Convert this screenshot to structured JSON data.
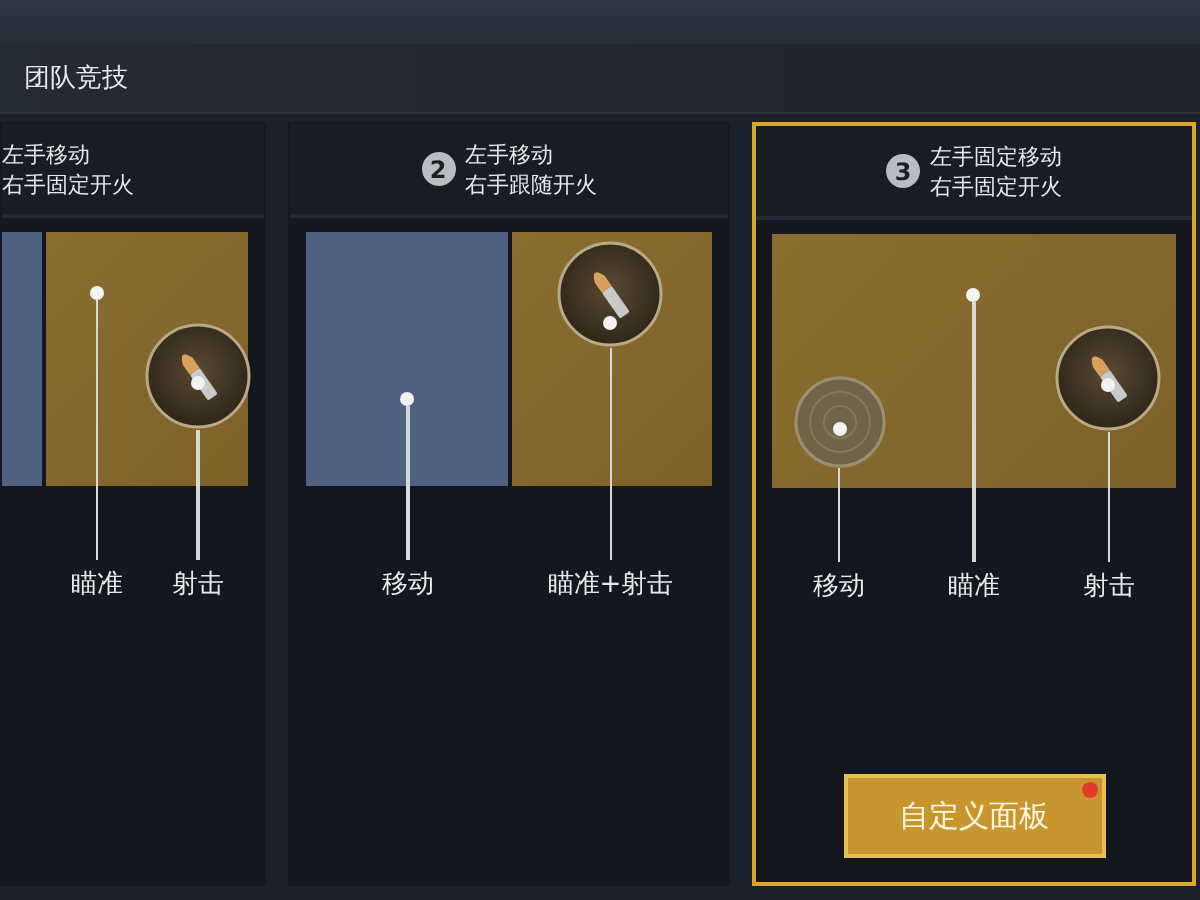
{
  "title": "团队竞技",
  "cards": [
    {
      "cut_left": true,
      "selected": false,
      "lines": [
        "左手移动",
        "右手固定开火"
      ],
      "zones": [
        {
          "kind": "move"
        },
        {
          "kind": "aim"
        }
      ],
      "callouts": [
        {
          "kind": "point",
          "label": "瞄准"
        },
        {
          "kind": "fire",
          "label": "射击"
        }
      ]
    },
    {
      "cut_left": false,
      "number": "2",
      "selected": false,
      "lines": [
        "左手移动",
        "右手跟随开火"
      ],
      "zones": [
        {
          "kind": "move"
        },
        {
          "kind": "aim"
        }
      ],
      "callouts": [
        {
          "kind": "low-point",
          "label": "移动"
        },
        {
          "kind": "fire-top",
          "label": "瞄准+射击"
        }
      ]
    },
    {
      "cut_left": false,
      "number": "3",
      "selected": true,
      "lines": [
        "左手固定移动",
        "右手固定开火"
      ],
      "zones": [
        {
          "kind": "aim"
        }
      ],
      "callouts": [
        {
          "kind": "joystick",
          "label": "移动"
        },
        {
          "kind": "point",
          "label": "瞄准"
        },
        {
          "kind": "fire",
          "label": "射击"
        }
      ],
      "button": {
        "label": "自定义面板",
        "badge": true
      }
    }
  ]
}
